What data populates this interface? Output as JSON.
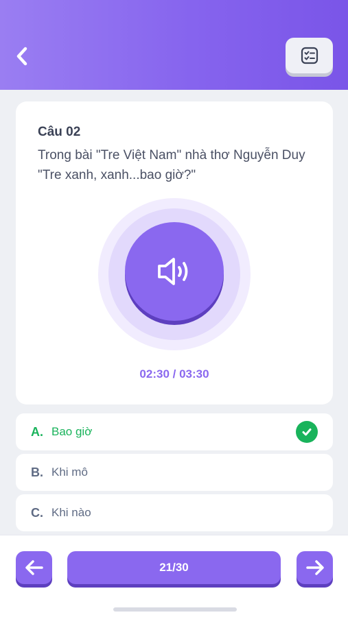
{
  "header": {
    "back_icon": "chevron-left-icon",
    "list_icon": "checklist-icon",
    "gradient_start": "#9a7ef2",
    "gradient_end": "#7a55e8"
  },
  "question": {
    "number": "Câu 02",
    "text": "Trong bài \"Tre Việt Nam\" nhà thơ Nguyễn Duy  \"Tre xanh, xanh...bao giờ?\""
  },
  "audio": {
    "icon": "speaker-icon",
    "elapsed": "02:30",
    "separator": " / ",
    "total": "03:30",
    "display": "02:30 / 03:30"
  },
  "answers": [
    {
      "letter": "A.",
      "text": "Bao giờ",
      "correct": true
    },
    {
      "letter": "B.",
      "text": "Khi mô",
      "correct": false
    },
    {
      "letter": "C.",
      "text": "Khi nào",
      "correct": false
    }
  ],
  "footer": {
    "prev_icon": "arrow-left-icon",
    "next_icon": "arrow-right-icon",
    "progress": "21/30"
  },
  "colors": {
    "accent": "#8a68ef",
    "correct": "#19b35b",
    "text": "#4a5064"
  }
}
